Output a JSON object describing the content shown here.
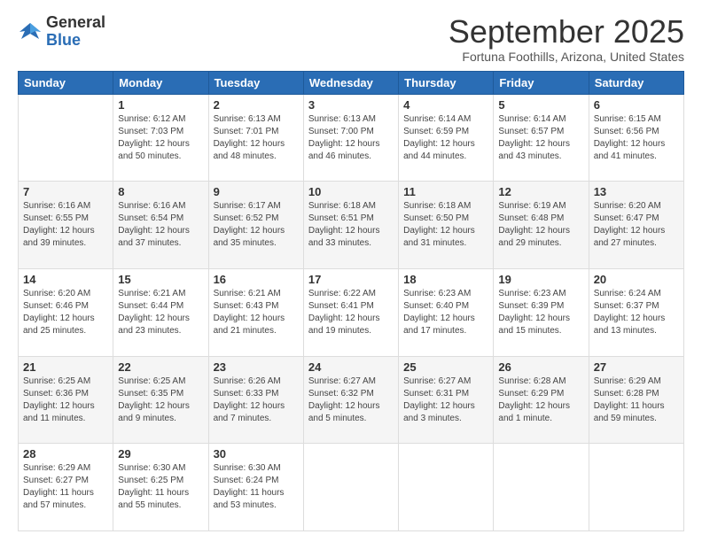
{
  "logo": {
    "general": "General",
    "blue": "Blue"
  },
  "header": {
    "month": "September 2025",
    "location": "Fortuna Foothills, Arizona, United States"
  },
  "days_of_week": [
    "Sunday",
    "Monday",
    "Tuesday",
    "Wednesday",
    "Thursday",
    "Friday",
    "Saturday"
  ],
  "weeks": [
    [
      {
        "day": "",
        "info": ""
      },
      {
        "day": "1",
        "info": "Sunrise: 6:12 AM\nSunset: 7:03 PM\nDaylight: 12 hours\nand 50 minutes."
      },
      {
        "day": "2",
        "info": "Sunrise: 6:13 AM\nSunset: 7:01 PM\nDaylight: 12 hours\nand 48 minutes."
      },
      {
        "day": "3",
        "info": "Sunrise: 6:13 AM\nSunset: 7:00 PM\nDaylight: 12 hours\nand 46 minutes."
      },
      {
        "day": "4",
        "info": "Sunrise: 6:14 AM\nSunset: 6:59 PM\nDaylight: 12 hours\nand 44 minutes."
      },
      {
        "day": "5",
        "info": "Sunrise: 6:14 AM\nSunset: 6:57 PM\nDaylight: 12 hours\nand 43 minutes."
      },
      {
        "day": "6",
        "info": "Sunrise: 6:15 AM\nSunset: 6:56 PM\nDaylight: 12 hours\nand 41 minutes."
      }
    ],
    [
      {
        "day": "7",
        "info": "Sunrise: 6:16 AM\nSunset: 6:55 PM\nDaylight: 12 hours\nand 39 minutes."
      },
      {
        "day": "8",
        "info": "Sunrise: 6:16 AM\nSunset: 6:54 PM\nDaylight: 12 hours\nand 37 minutes."
      },
      {
        "day": "9",
        "info": "Sunrise: 6:17 AM\nSunset: 6:52 PM\nDaylight: 12 hours\nand 35 minutes."
      },
      {
        "day": "10",
        "info": "Sunrise: 6:18 AM\nSunset: 6:51 PM\nDaylight: 12 hours\nand 33 minutes."
      },
      {
        "day": "11",
        "info": "Sunrise: 6:18 AM\nSunset: 6:50 PM\nDaylight: 12 hours\nand 31 minutes."
      },
      {
        "day": "12",
        "info": "Sunrise: 6:19 AM\nSunset: 6:48 PM\nDaylight: 12 hours\nand 29 minutes."
      },
      {
        "day": "13",
        "info": "Sunrise: 6:20 AM\nSunset: 6:47 PM\nDaylight: 12 hours\nand 27 minutes."
      }
    ],
    [
      {
        "day": "14",
        "info": "Sunrise: 6:20 AM\nSunset: 6:46 PM\nDaylight: 12 hours\nand 25 minutes."
      },
      {
        "day": "15",
        "info": "Sunrise: 6:21 AM\nSunset: 6:44 PM\nDaylight: 12 hours\nand 23 minutes."
      },
      {
        "day": "16",
        "info": "Sunrise: 6:21 AM\nSunset: 6:43 PM\nDaylight: 12 hours\nand 21 minutes."
      },
      {
        "day": "17",
        "info": "Sunrise: 6:22 AM\nSunset: 6:41 PM\nDaylight: 12 hours\nand 19 minutes."
      },
      {
        "day": "18",
        "info": "Sunrise: 6:23 AM\nSunset: 6:40 PM\nDaylight: 12 hours\nand 17 minutes."
      },
      {
        "day": "19",
        "info": "Sunrise: 6:23 AM\nSunset: 6:39 PM\nDaylight: 12 hours\nand 15 minutes."
      },
      {
        "day": "20",
        "info": "Sunrise: 6:24 AM\nSunset: 6:37 PM\nDaylight: 12 hours\nand 13 minutes."
      }
    ],
    [
      {
        "day": "21",
        "info": "Sunrise: 6:25 AM\nSunset: 6:36 PM\nDaylight: 12 hours\nand 11 minutes."
      },
      {
        "day": "22",
        "info": "Sunrise: 6:25 AM\nSunset: 6:35 PM\nDaylight: 12 hours\nand 9 minutes."
      },
      {
        "day": "23",
        "info": "Sunrise: 6:26 AM\nSunset: 6:33 PM\nDaylight: 12 hours\nand 7 minutes."
      },
      {
        "day": "24",
        "info": "Sunrise: 6:27 AM\nSunset: 6:32 PM\nDaylight: 12 hours\nand 5 minutes."
      },
      {
        "day": "25",
        "info": "Sunrise: 6:27 AM\nSunset: 6:31 PM\nDaylight: 12 hours\nand 3 minutes."
      },
      {
        "day": "26",
        "info": "Sunrise: 6:28 AM\nSunset: 6:29 PM\nDaylight: 12 hours\nand 1 minute."
      },
      {
        "day": "27",
        "info": "Sunrise: 6:29 AM\nSunset: 6:28 PM\nDaylight: 11 hours\nand 59 minutes."
      }
    ],
    [
      {
        "day": "28",
        "info": "Sunrise: 6:29 AM\nSunset: 6:27 PM\nDaylight: 11 hours\nand 57 minutes."
      },
      {
        "day": "29",
        "info": "Sunrise: 6:30 AM\nSunset: 6:25 PM\nDaylight: 11 hours\nand 55 minutes."
      },
      {
        "day": "30",
        "info": "Sunrise: 6:30 AM\nSunset: 6:24 PM\nDaylight: 11 hours\nand 53 minutes."
      },
      {
        "day": "",
        "info": ""
      },
      {
        "day": "",
        "info": ""
      },
      {
        "day": "",
        "info": ""
      },
      {
        "day": "",
        "info": ""
      }
    ]
  ]
}
